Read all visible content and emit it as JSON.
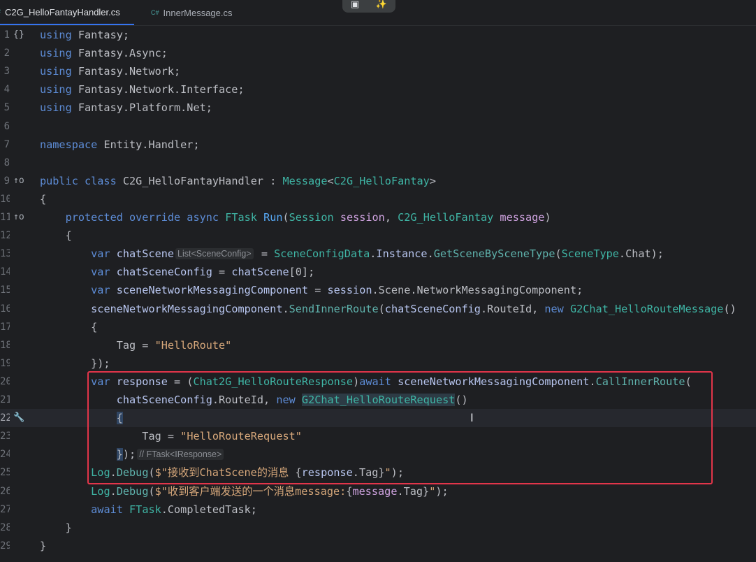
{
  "tabs": [
    {
      "label": "C2G_HelloFantayHandler.cs",
      "icon": "csharp-file-icon",
      "active": true
    },
    {
      "label": "InnerMessage.cs",
      "icon": "csharp-file-icon",
      "icon_text": "C#",
      "active": false
    }
  ],
  "toolbar": {
    "icon1": "window-icon",
    "icon2": "ai-sparkle-icon"
  },
  "editor": {
    "lines": [
      {
        "n": "1",
        "gutter": "{}",
        "tokens": [
          [
            "kw",
            "using"
          ],
          [
            "id",
            " Fantasy;"
          ]
        ]
      },
      {
        "n": "2",
        "tokens": [
          [
            "kw",
            "using"
          ],
          [
            "id",
            " Fantasy.Async;"
          ]
        ]
      },
      {
        "n": "3",
        "tokens": [
          [
            "kw",
            "using"
          ],
          [
            "id",
            " Fantasy.Network;"
          ]
        ]
      },
      {
        "n": "4",
        "tokens": [
          [
            "kw",
            "using"
          ],
          [
            "id",
            " Fantasy.Network.Interface;"
          ]
        ]
      },
      {
        "n": "5",
        "tokens": [
          [
            "kw",
            "using"
          ],
          [
            "id",
            " Fantasy.Platform.Net;"
          ]
        ]
      },
      {
        "n": "6",
        "tokens": []
      },
      {
        "n": "7",
        "tokens": [
          [
            "kw",
            "namespace"
          ],
          [
            "id",
            " Entity.Handler;"
          ]
        ]
      },
      {
        "n": "8",
        "tokens": []
      },
      {
        "n": "9",
        "gutter": "↑o",
        "tokens": [
          [
            "kw",
            "public class"
          ],
          [
            "id",
            " C2G_HelloFantayHandler"
          ],
          [
            "op",
            " : "
          ],
          [
            "type",
            "Message"
          ],
          [
            "op",
            "<"
          ],
          [
            "type",
            "C2G_HelloFantay"
          ],
          [
            "op",
            ">"
          ]
        ]
      },
      {
        "n": "10",
        "tokens": [
          [
            "op",
            "{"
          ]
        ]
      },
      {
        "n": "11",
        "gutter": "↑o",
        "tokens": [
          [
            "op",
            "    "
          ],
          [
            "kw",
            "protected override async"
          ],
          [
            "op",
            " "
          ],
          [
            "type",
            "FTask"
          ],
          [
            "op",
            " "
          ],
          [
            "method",
            "Run"
          ],
          [
            "op",
            "("
          ],
          [
            "type",
            "Session"
          ],
          [
            "param",
            " session"
          ],
          [
            "op",
            ", "
          ],
          [
            "type",
            "C2G_HelloFantay"
          ],
          [
            "param",
            " message"
          ],
          [
            "op",
            ")"
          ]
        ]
      },
      {
        "n": "12",
        "tokens": [
          [
            "op",
            "    {"
          ]
        ]
      },
      {
        "n": "13",
        "tokens": [
          [
            "op",
            "        "
          ],
          [
            "kw",
            "var"
          ],
          [
            "field",
            " chatScene"
          ],
          [
            "inlay",
            "List<SceneConfig>"
          ],
          [
            "op",
            " = "
          ],
          [
            "type",
            "SceneConfigData"
          ],
          [
            "op",
            "."
          ],
          [
            "field",
            "Instance"
          ],
          [
            "op",
            "."
          ],
          [
            "fn",
            "GetSceneBySceneType"
          ],
          [
            "op",
            "("
          ],
          [
            "type",
            "SceneType"
          ],
          [
            "op",
            ".Chat);"
          ]
        ]
      },
      {
        "n": "14",
        "tokens": [
          [
            "op",
            "        "
          ],
          [
            "kw",
            "var"
          ],
          [
            "field",
            " chatSceneConfig"
          ],
          [
            "op",
            " = "
          ],
          [
            "field",
            "chatScene"
          ],
          [
            "op",
            "[0];"
          ]
        ]
      },
      {
        "n": "15",
        "tokens": [
          [
            "op",
            "        "
          ],
          [
            "kw",
            "var"
          ],
          [
            "field",
            " sceneNetworkMessagingComponent"
          ],
          [
            "op",
            " = "
          ],
          [
            "field",
            "session"
          ],
          [
            "op",
            ".Scene.NetworkMessagingComponent;"
          ]
        ]
      },
      {
        "n": "16",
        "tokens": [
          [
            "op",
            "        "
          ],
          [
            "field",
            "sceneNetworkMessagingComponent"
          ],
          [
            "op",
            "."
          ],
          [
            "fn",
            "SendInnerRoute"
          ],
          [
            "op",
            "("
          ],
          [
            "field",
            "chatSceneConfig"
          ],
          [
            "op",
            ".RouteId, "
          ],
          [
            "kw",
            "new"
          ],
          [
            "op",
            " "
          ],
          [
            "type",
            "G2Chat_HelloRouteMessage"
          ],
          [
            "op",
            "()"
          ]
        ]
      },
      {
        "n": "17",
        "tokens": [
          [
            "op",
            "        {"
          ]
        ]
      },
      {
        "n": "18",
        "tokens": [
          [
            "op",
            "            Tag = "
          ],
          [
            "str",
            "\"HelloRoute\""
          ]
        ]
      },
      {
        "n": "19",
        "tokens": [
          [
            "op",
            "        });"
          ]
        ]
      },
      {
        "n": "20",
        "tokens": [
          [
            "op",
            "        "
          ],
          [
            "kw",
            "var"
          ],
          [
            "field",
            " response"
          ],
          [
            "op",
            " = ("
          ],
          [
            "type",
            "Chat2G_HelloRouteResponse"
          ],
          [
            "op",
            ")"
          ],
          [
            "kw",
            "await"
          ],
          [
            "op",
            " "
          ],
          [
            "field",
            "sceneNetworkMessagingComponent"
          ],
          [
            "op",
            "."
          ],
          [
            "fn",
            "CallInnerRoute"
          ],
          [
            "op",
            "("
          ]
        ]
      },
      {
        "n": "21",
        "tokens": [
          [
            "op",
            "            "
          ],
          [
            "field",
            "chatSceneConfig"
          ],
          [
            "op",
            ".RouteId, "
          ],
          [
            "kw",
            "new"
          ],
          [
            "op",
            " "
          ],
          [
            "marktype",
            "G2Chat_HelloRouteRequest"
          ],
          [
            "op",
            "()"
          ]
        ]
      },
      {
        "n": "22",
        "gutter": "🔧",
        "current": true,
        "tokens": [
          [
            "op",
            "            "
          ],
          [
            "brace",
            "{"
          ]
        ]
      },
      {
        "n": "23",
        "tokens": [
          [
            "op",
            "                Tag = "
          ],
          [
            "str",
            "\"HelloRouteRequest\""
          ]
        ]
      },
      {
        "n": "24",
        "tokens": [
          [
            "op",
            "            "
          ],
          [
            "brace",
            "}"
          ],
          [
            "op",
            ");"
          ],
          [
            "inlay",
            "// FTask<IResponse>"
          ]
        ]
      },
      {
        "n": "25",
        "tokens": [
          [
            "op",
            "        "
          ],
          [
            "type",
            "Log"
          ],
          [
            "op",
            "."
          ],
          [
            "fn",
            "Debug"
          ],
          [
            "op",
            "("
          ],
          [
            "str",
            "$\"接收到ChatScene的消息 "
          ],
          [
            "op",
            "{"
          ],
          [
            "field",
            "response"
          ],
          [
            "op",
            ".Tag}"
          ],
          [
            "str",
            "\""
          ],
          [
            "op",
            ");"
          ]
        ]
      },
      {
        "n": "26",
        "tokens": [
          [
            "op",
            "        "
          ],
          [
            "type",
            "Log"
          ],
          [
            "op",
            "."
          ],
          [
            "fn",
            "Debug"
          ],
          [
            "op",
            "("
          ],
          [
            "str",
            "$\"收到客户端发送的一个消息message:"
          ],
          [
            "op",
            "{"
          ],
          [
            "param",
            "message"
          ],
          [
            "op",
            ".Tag}"
          ],
          [
            "str",
            "\""
          ],
          [
            "op",
            ");"
          ]
        ]
      },
      {
        "n": "27",
        "tokens": [
          [
            "op",
            "        "
          ],
          [
            "kw",
            "await"
          ],
          [
            "op",
            " "
          ],
          [
            "type",
            "FTask"
          ],
          [
            "op",
            ".CompletedTask;"
          ]
        ]
      },
      {
        "n": "28",
        "tokens": [
          [
            "op",
            "    }"
          ]
        ]
      },
      {
        "n": "29",
        "tokens": [
          [
            "op",
            "}"
          ]
        ]
      }
    ]
  }
}
